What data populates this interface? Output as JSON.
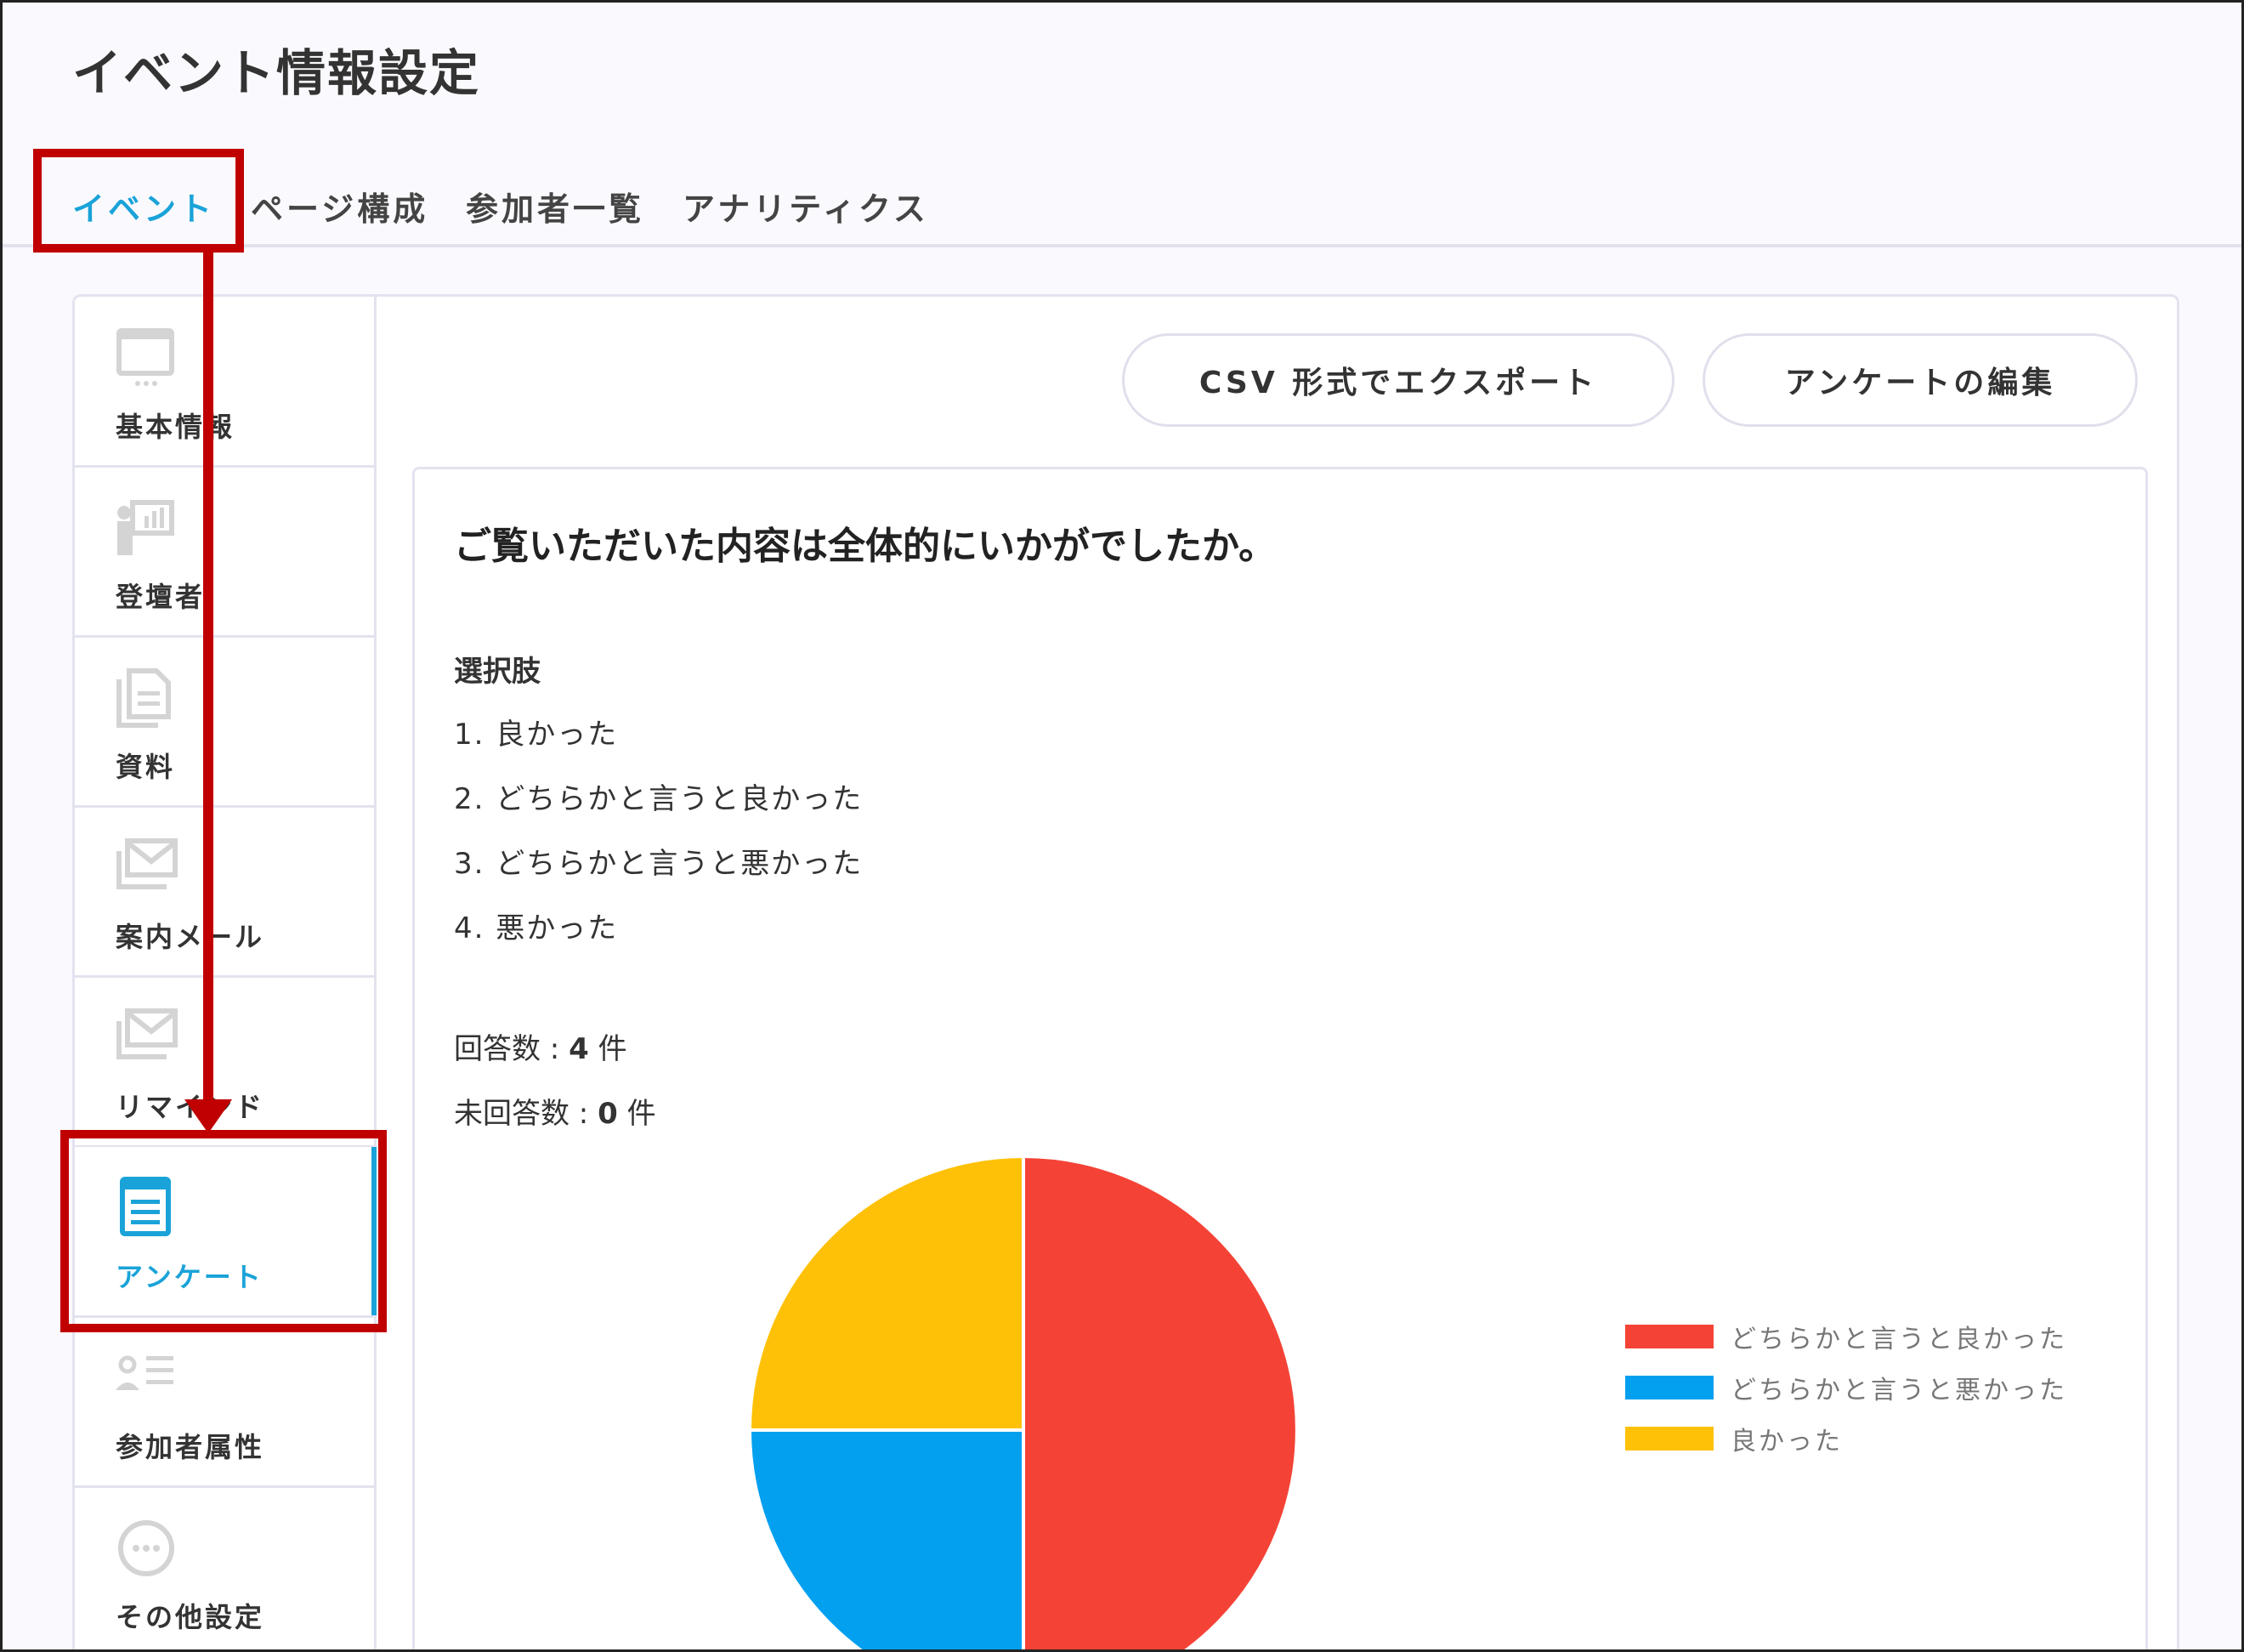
{
  "header": {
    "title": "イベント情報設定"
  },
  "tabs": [
    {
      "label": "イベント",
      "active": true
    },
    {
      "label": "ページ構成"
    },
    {
      "label": "参加者一覧"
    },
    {
      "label": "アナリティクス"
    }
  ],
  "sidebar": {
    "items": [
      {
        "label": "基本情報",
        "icon": "monitor-icon"
      },
      {
        "label": "登壇者",
        "icon": "presenter-icon"
      },
      {
        "label": "資料",
        "icon": "document-icon"
      },
      {
        "label": "案内メール",
        "icon": "mail-icon"
      },
      {
        "label": "リマインド",
        "icon": "mail-icon"
      },
      {
        "label": "アンケート",
        "icon": "survey-icon",
        "active": true
      },
      {
        "label": "参加者属性",
        "icon": "attribute-icon"
      },
      {
        "label": "その他設定",
        "icon": "more-icon"
      }
    ]
  },
  "toolbar": {
    "export_label": "CSV 形式でエクスポート",
    "edit_label": "アンケートの編集"
  },
  "question": {
    "title": "ご覧いただいた内容は全体的にいかがでしたか。",
    "choices_heading": "選択肢",
    "choices": [
      "1. 良かった",
      "2. どちらかと言うと良かった",
      "3. どちらかと言うと悪かった",
      "4. 悪かった"
    ],
    "answered_label": "回答数 : ",
    "answered_value": "4",
    "unanswered_label": "未回答数 : ",
    "unanswered_value": "0",
    "unit": "件"
  },
  "chart_data": {
    "type": "pie",
    "slices": [
      {
        "label": "どちらかと言うと良かった",
        "value": 2,
        "color": "#f44336"
      },
      {
        "label": "どちらかと言うと悪かった",
        "value": 1,
        "color": "#03a0f0"
      },
      {
        "label": "良かった",
        "value": 1,
        "color": "#ffc107"
      }
    ],
    "legend_position": "right"
  },
  "colors": {
    "accent": "#1aa3d8",
    "annotation": "#c00000"
  }
}
